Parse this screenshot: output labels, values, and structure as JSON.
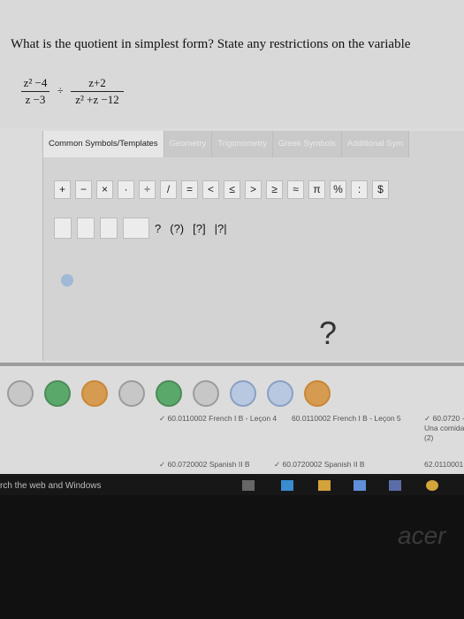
{
  "question": {
    "text": "What is the quotient in simplest form? State any restrictions on the variable",
    "expr": {
      "num1": "z² −4",
      "den1": "z −3",
      "op": "÷",
      "num2": "z+2",
      "den2": "z² +z −12"
    }
  },
  "tabs": [
    {
      "label": "Common Symbols/Templates"
    },
    {
      "label": "Geometry"
    },
    {
      "label": "Trigonometry"
    },
    {
      "label": "Greek Symbols"
    },
    {
      "label": "Additional Sym"
    }
  ],
  "toolbar": [
    "+",
    "−",
    "×",
    "·",
    "÷",
    "/",
    "=",
    "<",
    "≤",
    ">",
    "≥",
    "≈",
    "π",
    "%",
    ":",
    "$"
  ],
  "templates": [
    "?",
    "(?)",
    "[?]",
    "|?|"
  ],
  "placeholder": "?",
  "files": [
    {
      "label": "✓ 60.0110002 French I B - Leçon 4"
    },
    {
      "label": "60.0110002 French I B - Leçon 5"
    },
    {
      "label": "✓ 60.0720 - Una comida (2)"
    },
    {
      "label": "✓ 60.0720002 Spanish II B"
    },
    {
      "label": "✓ 60.0720002 Spanish II B"
    },
    {
      "label": "62.0110001"
    }
  ],
  "taskbar": {
    "search_text": "rch the web and Windows"
  },
  "bezel": {
    "brand": "acer"
  }
}
